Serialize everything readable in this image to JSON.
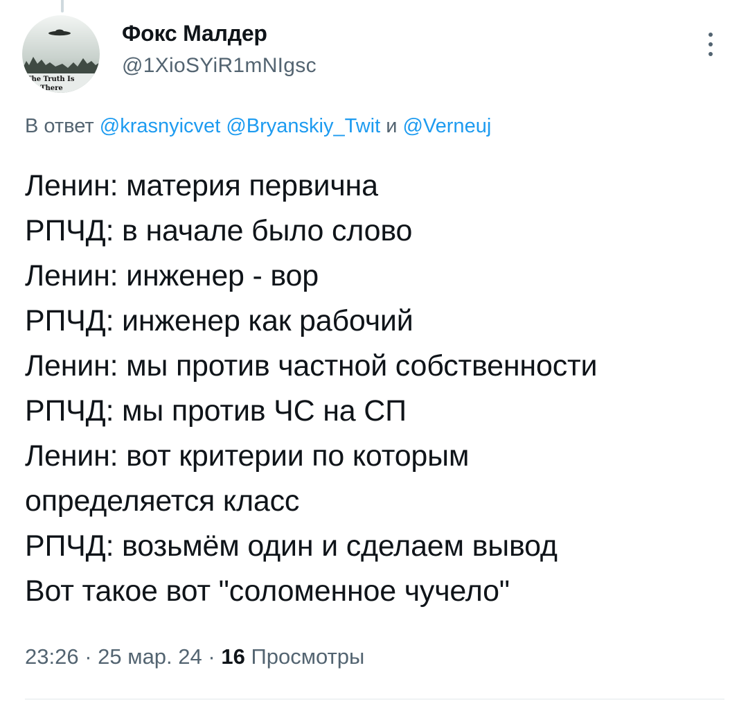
{
  "tweet": {
    "author": {
      "display_name": "Фокс Малдер",
      "handle": "@1XioSYiR1mNIgsc",
      "avatar_text_1": "The Truth Is",
      "avatar_text_2": "Out There"
    },
    "reply": {
      "prefix": "В ответ",
      "mentions": [
        "@krasnyicvet",
        "@Bryanskiy_Twit",
        "@Verneuj"
      ],
      "conjunction": "и"
    },
    "lines": [
      "Ленин: материя первична",
      "РПЧД: в начале было слово",
      "Ленин: инженер - вор",
      "РПЧД: инженер как рабочий",
      "Ленин: мы против частной собственности",
      "РПЧД: мы против ЧС на СП",
      "Ленин: вот критерии по которым",
      "определяется класс",
      "РПЧД: возьмём один и сделаем вывод",
      "Вот такое вот \"соломенное чучело\""
    ],
    "meta": {
      "time": "23:26",
      "separator": "·",
      "date": "25 мар. 24",
      "views_count": "16",
      "views_label": "Просмотры"
    }
  },
  "icons": {
    "more": "more-vertical-icon",
    "avatar": "ufo-avatar-image"
  },
  "colors": {
    "accent": "#1d9bf0",
    "secondary_text": "#536471",
    "primary_text": "#0f1419"
  }
}
